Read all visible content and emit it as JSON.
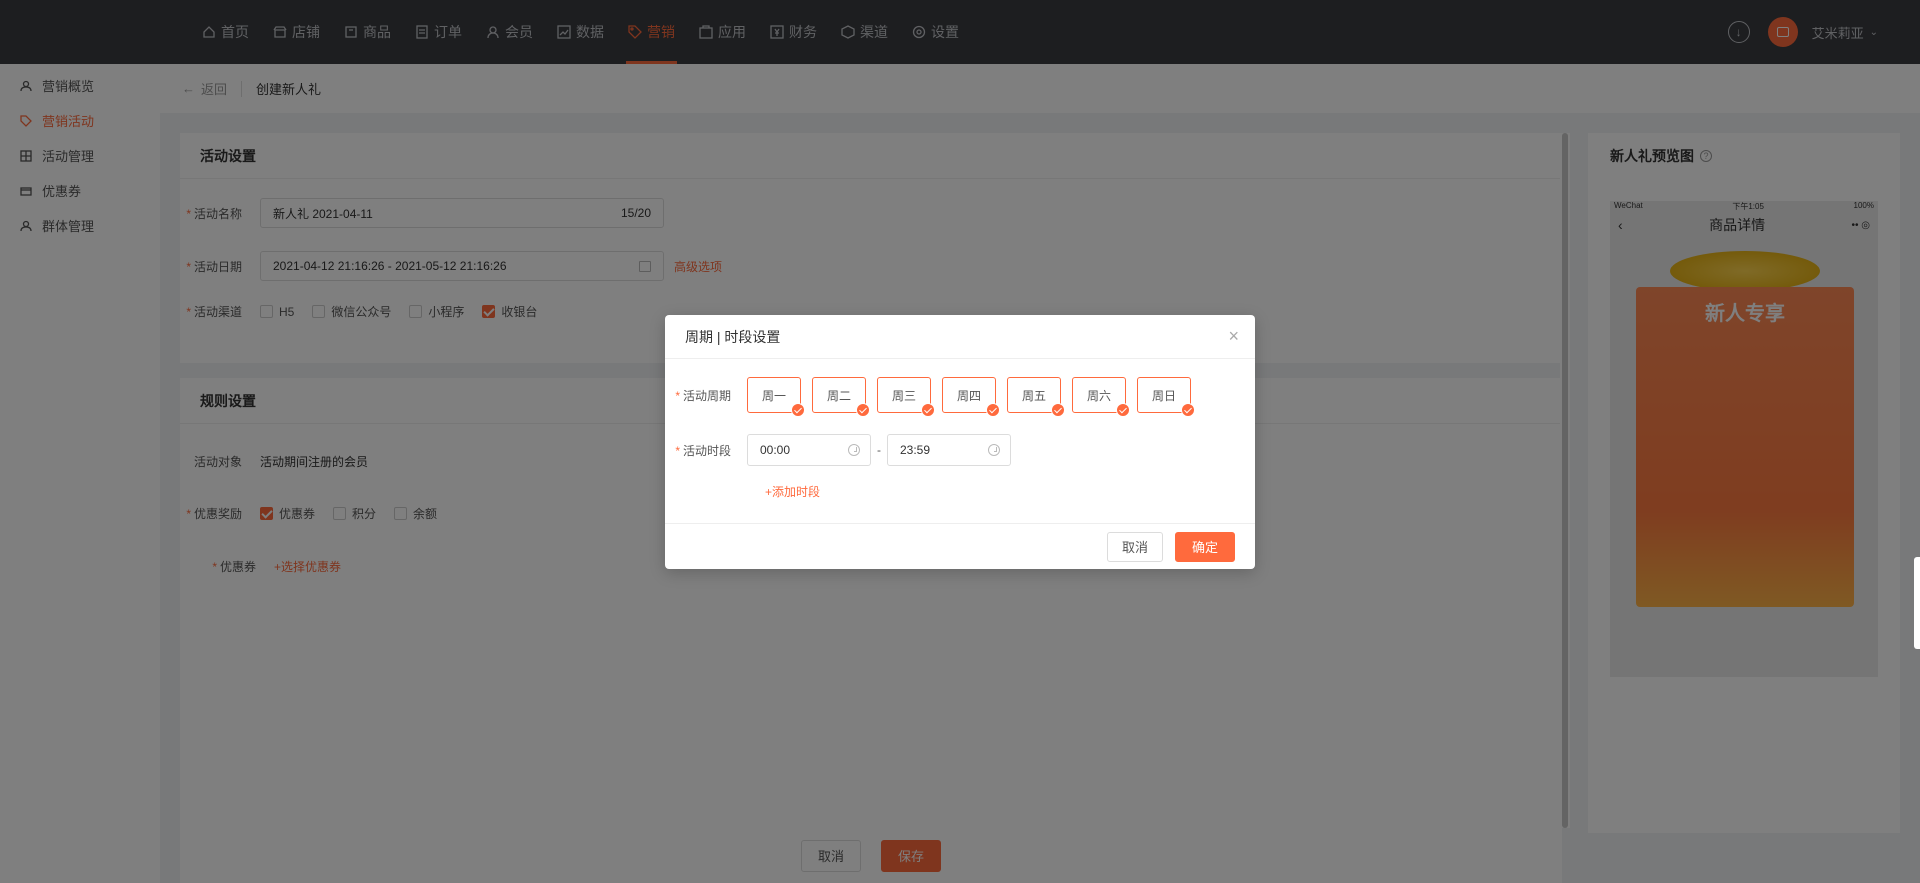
{
  "topnav": {
    "items": [
      {
        "label": "首页",
        "icon": "home-icon"
      },
      {
        "label": "店铺",
        "icon": "shop-icon"
      },
      {
        "label": "商品",
        "icon": "goods-icon"
      },
      {
        "label": "订单",
        "icon": "order-icon"
      },
      {
        "label": "会员",
        "icon": "user-icon"
      },
      {
        "label": "数据",
        "icon": "chart-icon"
      },
      {
        "label": "营销",
        "icon": "tag-icon"
      },
      {
        "label": "应用",
        "icon": "app-icon"
      },
      {
        "label": "财务",
        "icon": "finance-icon"
      },
      {
        "label": "渠道",
        "icon": "channel-icon"
      },
      {
        "label": "设置",
        "icon": "gear-icon"
      }
    ],
    "active": "营销",
    "username": "艾米莉亚"
  },
  "sidebar": {
    "items": [
      {
        "label": "营销概览"
      },
      {
        "label": "营销活动"
      },
      {
        "label": "活动管理"
      },
      {
        "label": "优惠券"
      },
      {
        "label": "群体管理"
      }
    ],
    "active": "营销活动"
  },
  "breadcrumb": {
    "back": "返回",
    "title": "创建新人礼"
  },
  "activity": {
    "title": "活动设置",
    "name_label": "活动名称",
    "name_value": "新人礼  2021-04-11",
    "name_count": "15/20",
    "date_label": "活动日期",
    "date_value": "2021-04-12 21:16:26 - 2021-05-12 21:16:26",
    "advanced": "高级选项",
    "channel_label": "活动渠道",
    "channels": [
      {
        "label": "H5",
        "checked": false
      },
      {
        "label": "微信公众号",
        "checked": false
      },
      {
        "label": "小程序",
        "checked": false
      },
      {
        "label": "收银台",
        "checked": true
      }
    ]
  },
  "rules": {
    "title": "规则设置",
    "target_label": "活动对象",
    "target_value": "活动期间注册的会员",
    "reward_label": "优惠奖励",
    "rewards": [
      {
        "label": "优惠券",
        "checked": true
      },
      {
        "label": "积分",
        "checked": false
      },
      {
        "label": "余额",
        "checked": false
      }
    ],
    "coupon_label": "优惠券",
    "coupon_link": "+选择优惠券"
  },
  "preview": {
    "title": "新人礼预览图",
    "status_left": "WeChat",
    "status_time": "下午1:05",
    "status_right": "100%",
    "page_title": "商品详情",
    "banner": "新人专享"
  },
  "footer": {
    "cancel": "取消",
    "save": "保存"
  },
  "modal": {
    "title": "周期 | 时段设置",
    "period_label": "活动周期",
    "days": [
      "周一",
      "周二",
      "周三",
      "周四",
      "周五",
      "周六",
      "周日"
    ],
    "time_label": "活动时段",
    "start": "00:00",
    "end": "23:59",
    "dash": "-",
    "add_link": "+添加时段",
    "cancel": "取消",
    "ok": "确定"
  },
  "colors": {
    "accent": "#ff6a3d",
    "topbar": "#3a3c41"
  }
}
